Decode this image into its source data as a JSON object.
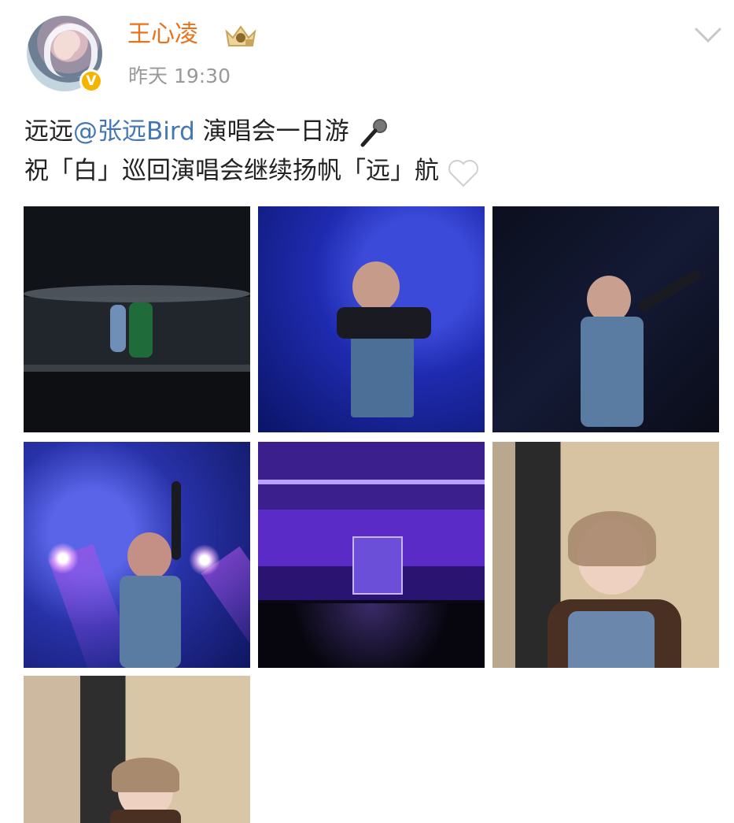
{
  "post": {
    "author": "王心凌",
    "timestamp": "昨天 19:30",
    "verified_badge": "V",
    "text_line1_prefix": "远远",
    "mention": "@张远Bird",
    "text_line1_suffix": " 演唱会一日游",
    "text_line2": "祝「白」巡回演唱会继续扬帆「远」航",
    "line1_emoji": "microphone-icon",
    "line2_emoji": "white-heart-icon"
  },
  "colors": {
    "author": "#e8721c",
    "mention": "#4277b4",
    "timestamp": "#999999",
    "verified": "#f4b400"
  },
  "photos": [
    {
      "name": "stage-duo-photo"
    },
    {
      "name": "singer-blue-stage-photo"
    },
    {
      "name": "singer-wave-dark-photo"
    },
    {
      "name": "singer-spotlights-photo"
    },
    {
      "name": "arena-purple-photo"
    },
    {
      "name": "backstage-selfie-photo"
    },
    {
      "name": "backstage-selfie-photo-2"
    }
  ]
}
